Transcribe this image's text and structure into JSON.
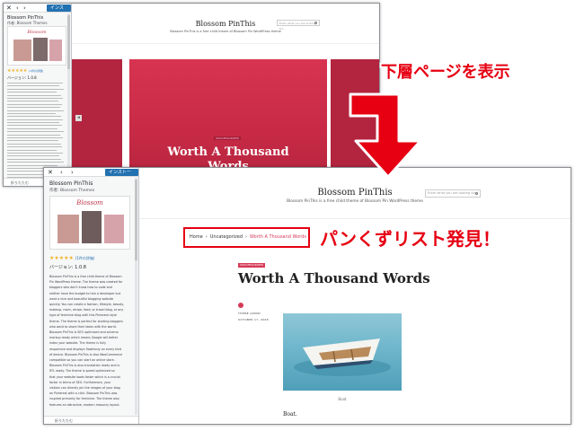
{
  "customizer": {
    "close_icon": "close-icon",
    "prev_icon": "chevron-left-icon",
    "next_icon": "chevron-right-icon",
    "install_label": "インストール",
    "theme_name": "Blossom PinThis",
    "theme_author": "作者: Blossom Themes",
    "stars": "★★★★★",
    "rating_count": "(1件の評価)",
    "version": "バージョン: 1.0.8",
    "logo_text": "Blossom",
    "description": [
      "Blossom PinThis is a free child theme of Blossom",
      "Pin WordPress theme. The theme was created for",
      "bloggers who don't know how to code and",
      "neither have the budget to hire a developer but",
      "want a nice and beautiful blogging website",
      "quickly. You can create a fashion, lifestyle, beauty,",
      "makeup, mom, recipe, food, or travel blog, or any",
      "type of feminine blog with this Pinterest style",
      "theme. The theme is perfect for starting bloggers",
      "who want to share their ideas with the world.",
      "Blossom PinThis is SEO optimized and schema",
      "markup ready which means Google will better",
      "index your website. The theme is fully",
      "responsive and displays flawlessly on every kind",
      "of device. Blossom PinThis is also WooCommerce",
      "compatible so you can start an online store.",
      "Blossom PinThis is also translation ready and is",
      "RTL ready. The theme is speed optimized so",
      "that your website loads faster which is a crucial",
      "factor in terms of SEO. Furthermore, your",
      "visitors can directly pin the images of your blog",
      "on Pinterest with a click. Blossom PinThis was",
      "inspired primarily for feminine. The theme also",
      "features an attractive, modern masonry layout."
    ],
    "collapse_label": "折りたたむ"
  },
  "site": {
    "title": "Blossom PinThis",
    "tagline": "Blossom PinThis is a free child theme of Blossom Pin WordPress theme",
    "search_placeholder": "Enter what you are looking for..."
  },
  "slider": {
    "prev_icon": "chevron-left-icon",
    "category": "UNCATEGORIZED",
    "title_line1": "Worth A Thousand",
    "title_line2": "Words"
  },
  "breadcrumb": {
    "home": "Home",
    "separator": "›",
    "category": "Uncategorized",
    "current": "Worth A Thousand Words"
  },
  "post": {
    "category": "UNCATEGORIZED",
    "title": "Worth A Thousand Words",
    "author_label": "THEME ADMIN",
    "date": "OCTOBER 17, 2008",
    "caption": "Boat",
    "body_start": "Boat."
  },
  "annotations": {
    "subpage": "下層ページを表示",
    "breadcrumb_found": "パンくずリスト発見！",
    "arrow_icon": "arrow-down-icon",
    "colors": {
      "text": "#e60012",
      "outline": "#ffffff"
    }
  }
}
